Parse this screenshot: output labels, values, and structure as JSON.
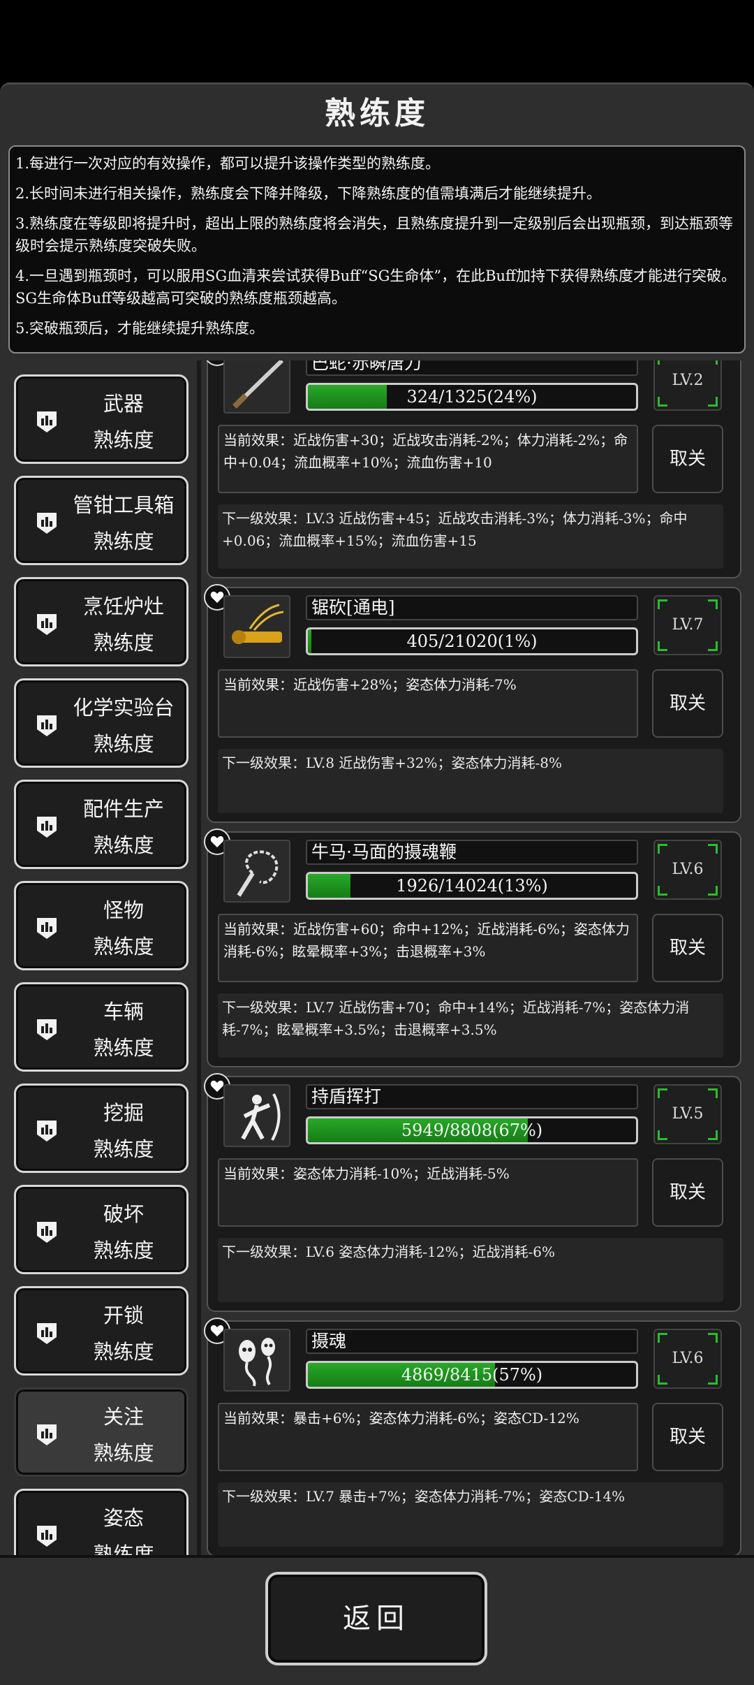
{
  "header": {
    "title": "熟练度"
  },
  "notes": [
    "1.每进行一次对应的有效操作，都可以提升该操作类型的熟练度。",
    "2.长时间未进行相关操作，熟练度会下降并降级，下降熟练度的值需填满后才能继续提升。",
    "3.熟练度在等级即将提升时，超出上限的熟练度将会消失，且熟练度提升到一定级别后会出现瓶颈，到达瓶颈等级时会提示熟练度突破失败。",
    "4.一旦遇到瓶颈时，可以服用SG血清来尝试获得Buff“SG生命体”，在此Buff加持下获得熟练度才能进行突破。SG生命体Buff等级越高可突破的熟练度瓶颈越高。",
    "5.突破瓶颈后，才能继续提升熟练度。"
  ],
  "categories": [
    {
      "l1": "武器",
      "l2": "熟练度",
      "selected": false
    },
    {
      "l1": "管钳工具箱",
      "l2": "熟练度",
      "selected": false
    },
    {
      "l1": "烹饪炉灶",
      "l2": "熟练度",
      "selected": false
    },
    {
      "l1": "化学实验台",
      "l2": "熟练度",
      "selected": false
    },
    {
      "l1": "配件生产",
      "l2": "熟练度",
      "selected": false
    },
    {
      "l1": "怪物",
      "l2": "熟练度",
      "selected": false
    },
    {
      "l1": "车辆",
      "l2": "熟练度",
      "selected": false
    },
    {
      "l1": "挖掘",
      "l2": "熟练度",
      "selected": false
    },
    {
      "l1": "破坏",
      "l2": "熟练度",
      "selected": false
    },
    {
      "l1": "开锁",
      "l2": "熟练度",
      "selected": false
    },
    {
      "l1": "关注",
      "l2": "熟练度",
      "selected": true
    },
    {
      "l1": "姿态",
      "l2": "熟练度",
      "selected": false
    }
  ],
  "skills": [
    {
      "name": "巴蛇·赤瞬唐刀",
      "progress": "324/1325(24%)",
      "fraction": 0.24,
      "level": "LV.2",
      "current": "当前效果：近战伤害+30；近战攻击消耗-2%；体力消耗-2%；命中+0.04；流血概率+10%；流血伤害+10",
      "next": "下一级效果：LV.3 近战伤害+45；近战攻击消耗-3%；体力消耗-3%；命中+0.06；流血概率+15%；流血伤害+15",
      "cancel": "取关",
      "icon": "blade-icon"
    },
    {
      "name": "锯砍[通电]",
      "progress": "405/21020(1%)",
      "fraction": 0.01,
      "level": "LV.7",
      "current": "当前效果：近战伤害+28%；姿态体力消耗-7%",
      "next": "下一级效果：LV.8 近战伤害+32%；姿态体力消耗-8%",
      "cancel": "取关",
      "icon": "chainsaw-icon"
    },
    {
      "name": "牛马·马面的摄魂鞭",
      "progress": "1926/14024(13%)",
      "fraction": 0.13,
      "level": "LV.6",
      "current": "当前效果：近战伤害+60；命中+12%；近战消耗-6%；姿态体力消耗-6%；眩晕概率+3%；击退概率+3%",
      "next": "下一级效果：LV.7 近战伤害+70；命中+14%；近战消耗-7%；姿态体力消耗-7%；眩晕概率+3.5%；击退概率+3.5%",
      "cancel": "取关",
      "icon": "whip-icon"
    },
    {
      "name": "持盾挥打",
      "progress": "5949/8808(67%)",
      "fraction": 0.67,
      "level": "LV.5",
      "current": "当前效果：姿态体力消耗-10%；近战消耗-5%",
      "next": "下一级效果：LV.6 姿态体力消耗-12%；近战消耗-6%",
      "cancel": "取关",
      "icon": "shield-swing-icon"
    },
    {
      "name": "摄魂",
      "progress": "4869/8415(57%)",
      "fraction": 0.57,
      "level": "LV.6",
      "current": "当前效果：暴击+6%；姿态体力消耗-6%；姿态CD-12%",
      "next": "下一级效果：LV.7 暴击+7%；姿态体力消耗-7%；姿态CD-14%",
      "cancel": "取关",
      "icon": "soul-icon"
    }
  ],
  "footer": {
    "back_label": "返回"
  }
}
